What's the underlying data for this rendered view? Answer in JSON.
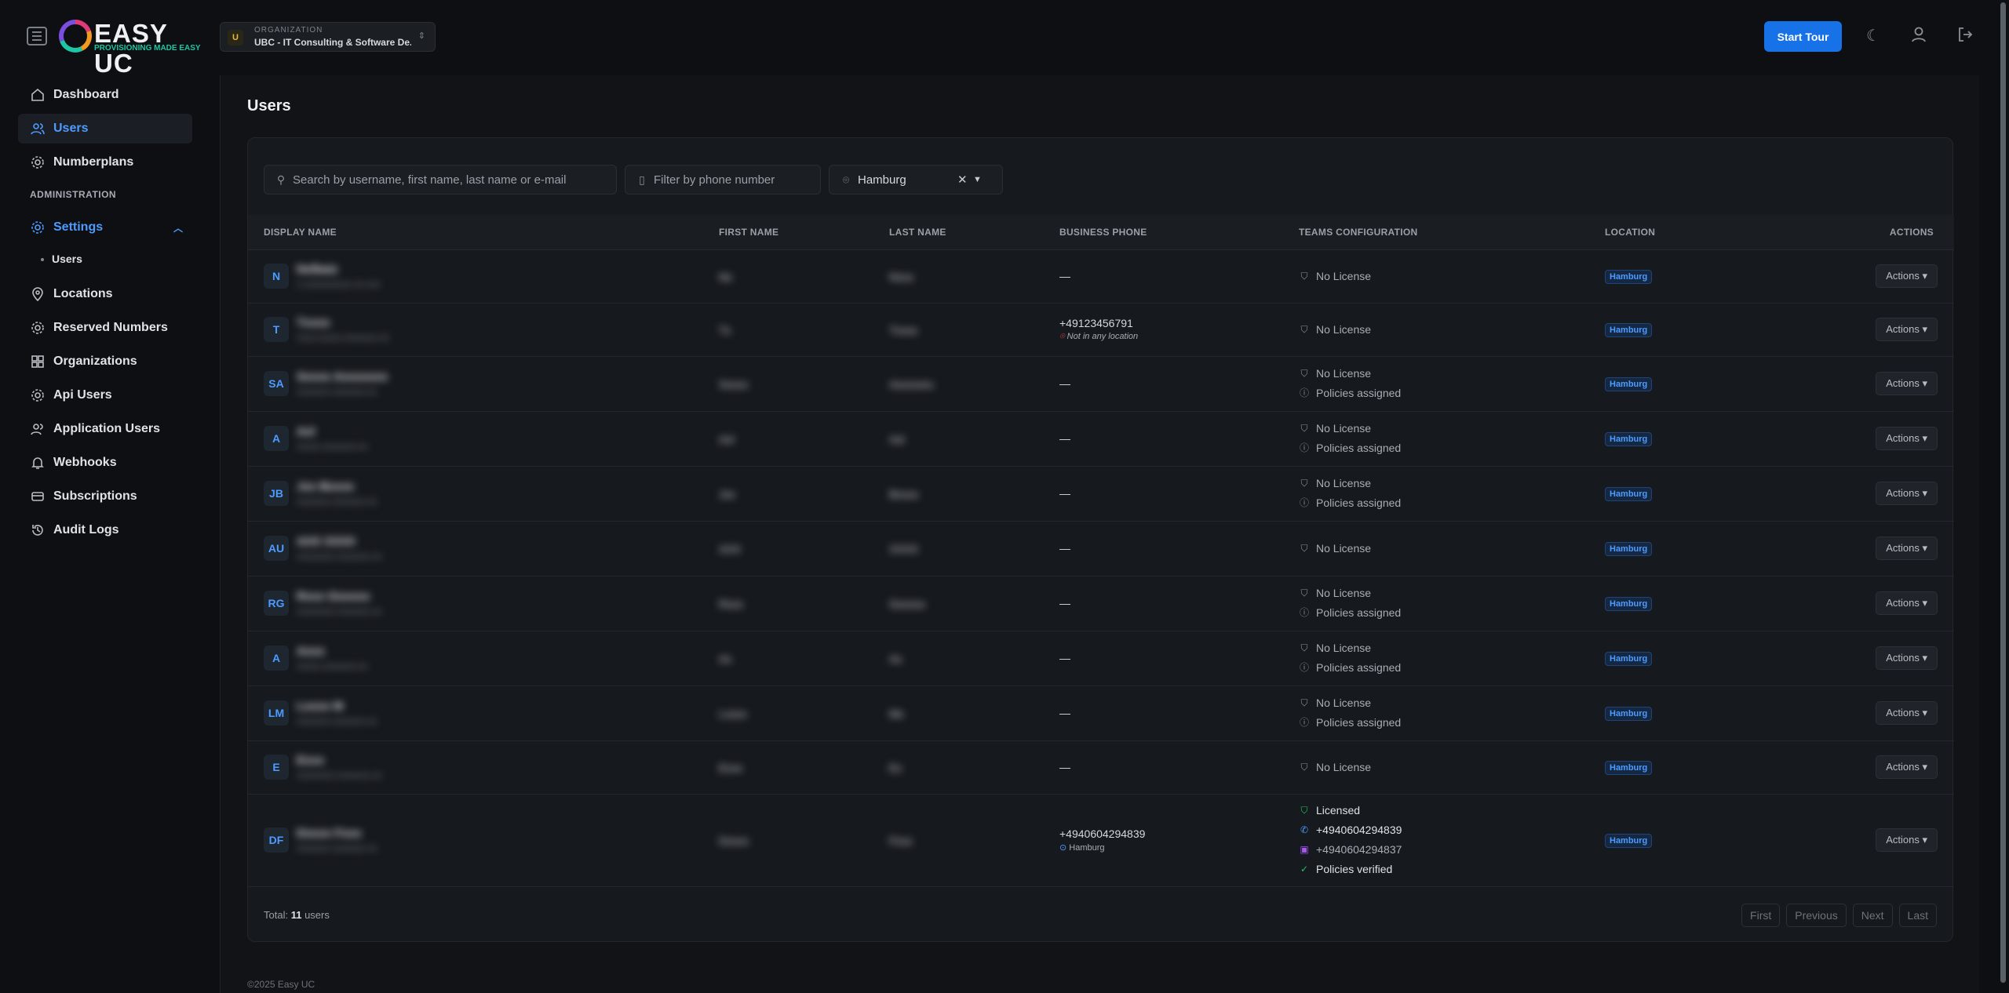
{
  "brand": {
    "name_light": "EASY",
    "name_bold": "UC",
    "tagline": "PROVISIONING MADE EASY"
  },
  "org": {
    "caption": "ORGANIZATION",
    "avatar": "U",
    "name": "UBC - IT Consulting & Software De..."
  },
  "header": {
    "tour_label": "Start Tour",
    "icons": [
      "moon-icon",
      "user-icon",
      "logout-icon"
    ]
  },
  "sidebar": {
    "items": [
      {
        "label": "Dashboard",
        "icon": "home-icon"
      },
      {
        "label": "Users",
        "icon": "users-icon"
      },
      {
        "label": "Numberplans",
        "icon": "gear-icon"
      }
    ],
    "section": "ADMINISTRATION",
    "admin": [
      {
        "label": "Settings",
        "icon": "gear-icon"
      },
      {
        "label": "Locations",
        "icon": "pin-icon"
      },
      {
        "label": "Reserved Numbers",
        "icon": "gear-icon"
      },
      {
        "label": "Organizations",
        "icon": "grid-icon"
      },
      {
        "label": "Api Users",
        "icon": "gear-icon"
      },
      {
        "label": "Application Users",
        "icon": "users-icon"
      },
      {
        "label": "Webhooks",
        "icon": "bell-icon"
      },
      {
        "label": "Subscriptions",
        "icon": "card-icon"
      },
      {
        "label": "Audit Logs",
        "icon": "history-icon"
      }
    ],
    "settings_sub": "Users"
  },
  "page": {
    "title": "Users"
  },
  "filters": {
    "search_placeholder": "Search by username, first name, last name or e-mail",
    "phone_placeholder": "Filter by phone number",
    "location_value": "Hamburg"
  },
  "table": {
    "columns": [
      "DISPLAY NAME",
      "FIRST NAME",
      "LAST NAME",
      "BUSINESS PHONE",
      "TEAMS CONFIGURATION",
      "LOCATION",
      "ACTIONS"
    ],
    "rows": [
      {
        "initials": "N",
        "name": "Nxlbaiz",
        "email": "n.xxxxxxxxxx.xx.xxx",
        "first": "Nx",
        "last": "Nxxx",
        "phone": "—",
        "phone_note": "",
        "teams": [
          "No License"
        ],
        "location": "Hamburg"
      },
      {
        "initials": "T",
        "name": "Txxxx",
        "email": "xxxx.xxxxx.xxxxxxx.xx",
        "first": "Tx",
        "last": "Txxxx",
        "phone": "+49123456791",
        "phone_note": "Not in any location",
        "teams": [
          "No License"
        ],
        "location": "Hamburg"
      },
      {
        "initials": "SA",
        "name": "Sxxxx Axxxxxxx",
        "email": "xxxxxxx.xxxxxxx.xx",
        "first": "Sxxxx",
        "last": "Axxxxxru",
        "phone": "—",
        "phone_note": "",
        "teams": [
          "No License",
          "Policies assigned"
        ],
        "location": "Hamburg"
      },
      {
        "initials": "A",
        "name": "Axl",
        "email": "xxxxx.xxxxxxx.xx",
        "first": "Axl",
        "last": "Axl",
        "phone": "—",
        "phone_note": "",
        "teams": [
          "No License",
          "Policies assigned"
        ],
        "location": "Hamburg"
      },
      {
        "initials": "JB",
        "name": "Jxx Bxxxx",
        "email": "xxxxxxx.xxxxxxx.xx",
        "first": "Jxx",
        "last": "Bxxxx",
        "phone": "—",
        "phone_note": "",
        "teams": [
          "No License",
          "Policies assigned"
        ],
        "location": "Hamburg"
      },
      {
        "initials": "AU",
        "name": "AXX XXXX",
        "email": "xxxxxxxx.xxxxxxx.xx",
        "first": "AXX",
        "last": "XXXX",
        "phone": "—",
        "phone_note": "",
        "teams": [
          "No License"
        ],
        "location": "Hamburg"
      },
      {
        "initials": "RG",
        "name": "Rxxx Gxxxxx",
        "email": "xxxxxxxx.xxxxxxx.xx",
        "first": "Rxxx",
        "last": "Gxxxxx",
        "phone": "—",
        "phone_note": "",
        "teams": [
          "No License",
          "Policies assigned"
        ],
        "location": "Hamburg"
      },
      {
        "initials": "A",
        "name": "Axxx",
        "email": "xxxxx.xxxxxxx.xx",
        "first": "Ax",
        "last": "Ax",
        "phone": "—",
        "phone_note": "",
        "teams": [
          "No License",
          "Policies assigned"
        ],
        "location": "Hamburg"
      },
      {
        "initials": "LM",
        "name": "Lxxxx M",
        "email": "xxxxxxx.xxxxxxx.xx",
        "first": "Lxxxx",
        "last": "Mx",
        "phone": "—",
        "phone_note": "",
        "teams": [
          "No License",
          "Policies assigned"
        ],
        "location": "Hamburg"
      },
      {
        "initials": "E",
        "name": "Exxx",
        "email": "xxxxxxxx.xxxxxxx.xx",
        "first": "Exxx",
        "last": "Ex",
        "phone": "—",
        "phone_note": "",
        "teams": [
          "No License"
        ],
        "location": "Hamburg"
      },
      {
        "initials": "DF",
        "name": "Dxxxx Fxxx",
        "email": "xxxxxxx.xxxxxxx.xx",
        "first": "Dxxxx",
        "last": "Fxxx",
        "phone": "+4940604294839",
        "phone_note": "Hamburg",
        "teams": [
          "Licensed",
          "+4940604294839",
          "+4940604294837",
          "Policies verified"
        ],
        "location": "Hamburg"
      }
    ],
    "action_label": "Actions"
  },
  "footer": {
    "total_prefix": "Total:",
    "total_count": "11",
    "total_suffix": "users",
    "pager": [
      "First",
      "Previous",
      "Next",
      "Last"
    ],
    "copyright": "©2025 Easy UC"
  },
  "colors": {
    "accent": "#1672e6",
    "link": "#4d9bff",
    "bg": "#0d0f12",
    "card": "#16191d"
  }
}
